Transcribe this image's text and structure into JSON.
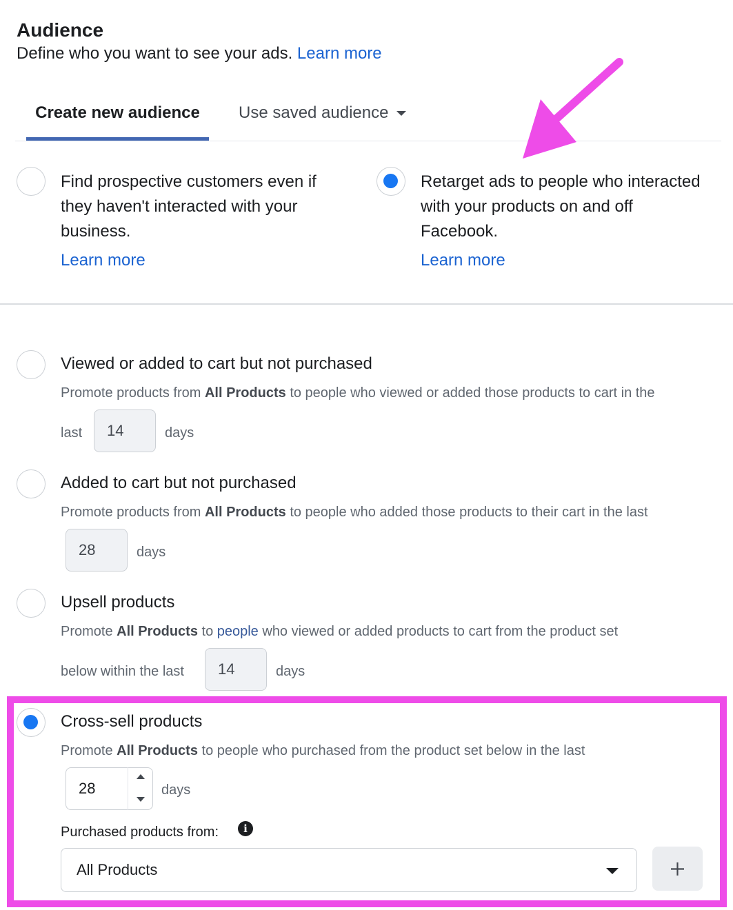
{
  "header": {
    "title": "Audience",
    "subtitle": "Define who you want to see your ads.",
    "learn_more": "Learn more"
  },
  "tabs": [
    {
      "label": "Create new audience",
      "active": true
    },
    {
      "label": "Use saved audience",
      "active": false
    }
  ],
  "audience_type": {
    "prospect": {
      "text": "Find prospective customers even if they haven't interacted with your business.",
      "learn_more": "Learn more",
      "selected": false
    },
    "retarget": {
      "text": "Retarget ads to people who interacted with your products on and off Facebook.",
      "learn_more": "Learn more",
      "selected": true
    }
  },
  "options": [
    {
      "title": "Viewed or added to cart but not purchased",
      "desc_pre": "Promote products from ",
      "desc_bold": "All Products",
      "desc_post": " to people who viewed or added those products to cart in the",
      "line2_pre": "last",
      "days": "14",
      "unit": "days",
      "selected": false
    },
    {
      "title": "Added to cart but not purchased",
      "desc_pre": "Promote products from ",
      "desc_bold": "All Products",
      "desc_post": " to people who added those products to their cart in the last",
      "days": "28",
      "unit": "days",
      "selected": false
    },
    {
      "title": "Upsell products",
      "desc_pre": "Promote ",
      "desc_bold": "All Products",
      "desc_mid": " to ",
      "desc_link": "people",
      "desc_post": " who viewed or added products to cart from the product set",
      "line2_pre": "below within the last",
      "days": "14",
      "unit": "days",
      "selected": false
    },
    {
      "title": "Cross-sell products",
      "desc_pre": "Promote ",
      "desc_bold": "All Products",
      "desc_post": " to people who purchased from the product set below in the last",
      "days": "28",
      "unit": "days",
      "selected": true
    }
  ],
  "purchased_from": {
    "label": "Purchased products from:",
    "info_icon": "i",
    "selected": "All Products",
    "add_icon": "+"
  },
  "colors": {
    "accent": "#1877f2",
    "link": "#1b63d1",
    "annotation": "#ee4ce8"
  }
}
